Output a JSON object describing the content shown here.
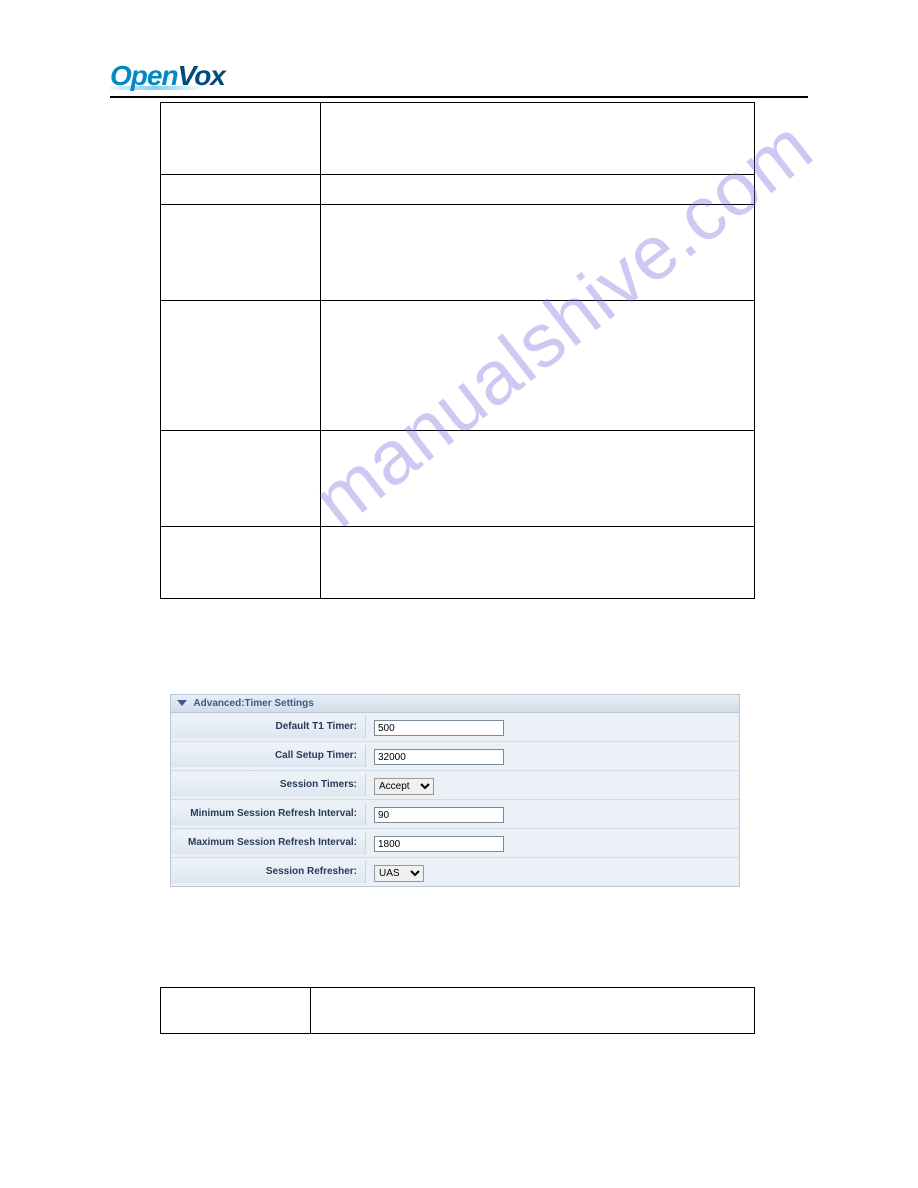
{
  "logo": {
    "part1": "Open",
    "part2": "Vox"
  },
  "panel": {
    "header": "Advanced:Timer Settings",
    "rows": [
      {
        "label": "Default T1 Timer:",
        "value": "500",
        "type": "text"
      },
      {
        "label": "Call Setup Timer:",
        "value": "32000",
        "type": "text"
      },
      {
        "label": "Session Timers:",
        "value": "Accept",
        "type": "select",
        "cls": "select-narrow"
      },
      {
        "label": "Minimum Session Refresh Interval:",
        "value": "90",
        "type": "text"
      },
      {
        "label": "Maximum Session Refresh Interval:",
        "value": "1800",
        "type": "text"
      },
      {
        "label": "Session Refresher:",
        "value": "UAS",
        "type": "select",
        "cls": "select-mid"
      }
    ]
  },
  "watermark": "manualshive.com"
}
